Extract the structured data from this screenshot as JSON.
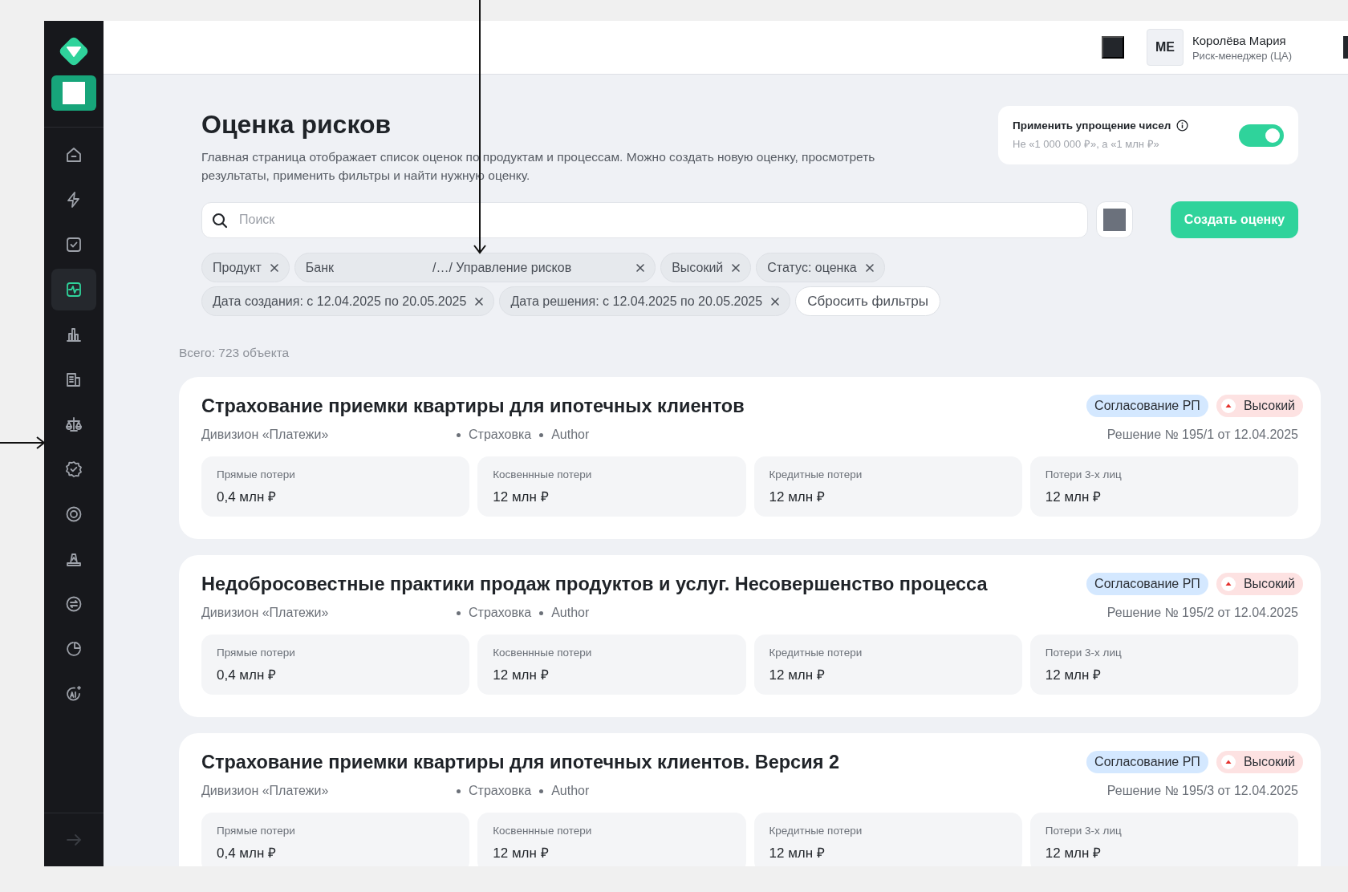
{
  "sidebar": {
    "items": [
      {
        "kind": "home",
        "selected": false
      },
      {
        "kind": "bolt",
        "selected": false
      },
      {
        "kind": "checkbox",
        "selected": false
      },
      {
        "kind": "pulse",
        "selected": true
      },
      {
        "kind": "bars",
        "selected": false
      },
      {
        "kind": "document",
        "selected": false
      },
      {
        "kind": "scales",
        "selected": false
      },
      {
        "kind": "badge",
        "selected": false
      },
      {
        "kind": "target",
        "selected": false
      },
      {
        "kind": "cone",
        "selected": false
      },
      {
        "kind": "exchange",
        "selected": false
      },
      {
        "kind": "pie",
        "selected": false
      },
      {
        "kind": "ai",
        "selected": false
      }
    ]
  },
  "header": {
    "user": {
      "initials": "ME",
      "name": "Королёва Мария",
      "role": "Риск-менеджер (ЦА)"
    }
  },
  "page": {
    "title": "Оценка рисков",
    "description": "Главная страница отображает список оценок по продуктам и процессам. Можно создать новую оценку, просмотреть результаты, применить фильтры и найти нужную оценку."
  },
  "simplify": {
    "label": "Применить упрощение чисел",
    "hint": "Не «1 000 000 ₽», а «1 млн ₽»",
    "on": true
  },
  "search": {
    "placeholder": "Поиск"
  },
  "create_button": "Создать оценку",
  "filters": [
    {
      "parts": [
        "Продукт"
      ]
    },
    {
      "parts": [
        "Банк",
        "/…/ Управление рисков"
      ]
    },
    {
      "parts": [
        "Высокий"
      ]
    },
    {
      "parts": [
        "Статус: оценка"
      ]
    },
    {
      "parts": [
        "Дата создания: с 12.04.2025 по 20.05.2025"
      ]
    },
    {
      "parts": [
        "Дата решения: с 12.04.2025 по 20.05.2025"
      ]
    }
  ],
  "reset_filters": "Сбросить фильтры",
  "total": "Всего: 723 объекта",
  "cards": [
    {
      "title": "Страхование приемки квартиры для ипотечных клиентов",
      "division": "Дивизион «Платежи»",
      "meta": [
        "Страховка",
        "Author"
      ],
      "tags": [
        {
          "kind": "status",
          "text": "Согласование РП"
        },
        {
          "kind": "priority",
          "text": "Высокий"
        }
      ],
      "decision": "Решение № 195/1 от 12.04.2025",
      "metrics": [
        {
          "label": "Прямые потери",
          "value": "0,4 млн ₽"
        },
        {
          "label": "Косвеннные потери",
          "value": "12 млн ₽"
        },
        {
          "label": "Кредитные потери",
          "value": "12 млн ₽"
        },
        {
          "label": "Потери 3-х лиц",
          "value": "12 млн ₽"
        }
      ]
    },
    {
      "title": "Недобросовестные практики продаж продуктов и услуг. Несовершенство процесса",
      "division": "Дивизион «Платежи»",
      "meta": [
        "Страховка",
        "Author"
      ],
      "tags": [
        {
          "kind": "status",
          "text": "Согласование РП"
        },
        {
          "kind": "priority",
          "text": "Высокий"
        }
      ],
      "decision": "Решение № 195/2 от 12.04.2025",
      "metrics": [
        {
          "label": "Прямые потери",
          "value": "0,4 млн ₽"
        },
        {
          "label": "Косвеннные потери",
          "value": "12 млн ₽"
        },
        {
          "label": "Кредитные потери",
          "value": "12 млн ₽"
        },
        {
          "label": "Потери 3-х лиц",
          "value": "12 млн ₽"
        }
      ]
    },
    {
      "title": "Страхование приемки квартиры для ипотечных клиентов. Версия 2",
      "division": "Дивизион «Платежи»",
      "meta": [
        "Страховка",
        "Author"
      ],
      "tags": [
        {
          "kind": "status",
          "text": "Согласование РП"
        },
        {
          "kind": "priority",
          "text": "Высокий"
        }
      ],
      "decision": "Решение № 195/3 от 12.04.2025",
      "metrics": [
        {
          "label": "Прямые потери",
          "value": "0,4 млн ₽"
        },
        {
          "label": "Косвеннные потери",
          "value": "12 млн ₽"
        },
        {
          "label": "Кредитные потери",
          "value": "12 млн ₽"
        },
        {
          "label": "Потери 3-х лиц",
          "value": "12 млн ₽"
        }
      ]
    }
  ]
}
